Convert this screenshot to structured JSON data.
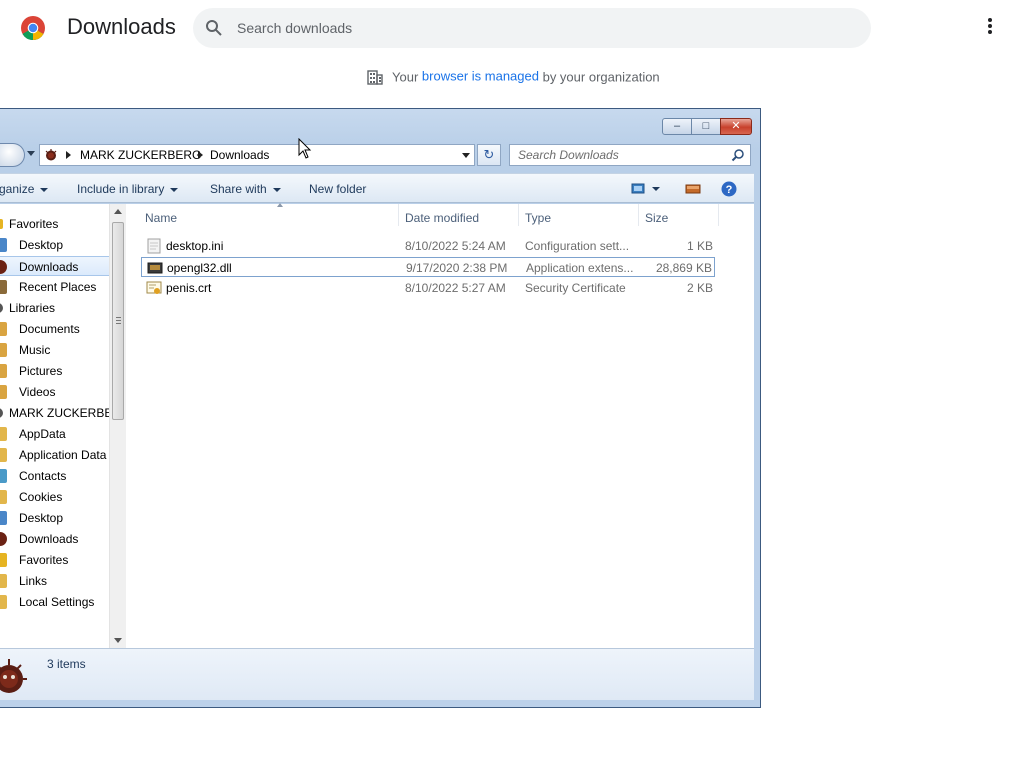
{
  "chrome": {
    "page_title": "Downloads",
    "search_placeholder": "Search downloads",
    "managed": {
      "prefix": "Your",
      "link": "browser is managed",
      "suffix": "by your organization"
    }
  },
  "explorer": {
    "breadcrumb": [
      "MARK ZUCKERBERG",
      "Downloads"
    ],
    "search_placeholder": "Search Downloads",
    "toolbar": {
      "organize": "ganize",
      "include_in_library": "Include in library",
      "share_with": "Share with",
      "new_folder": "New folder"
    },
    "nav_pane": [
      {
        "label": "Favorites",
        "icon": "star-icon",
        "group": true
      },
      {
        "label": "Desktop",
        "icon": "desktop-icon"
      },
      {
        "label": "Downloads",
        "icon": "downloads-folder-icon",
        "selected": true
      },
      {
        "label": "Recent Places",
        "icon": "recent-places-icon"
      },
      {
        "label": "Libraries",
        "icon": "libraries-icon",
        "group": true
      },
      {
        "label": "Documents",
        "icon": "documents-icon"
      },
      {
        "label": "Music",
        "icon": "music-icon"
      },
      {
        "label": "Pictures",
        "icon": "pictures-icon"
      },
      {
        "label": "Videos",
        "icon": "videos-icon"
      },
      {
        "label": "MARK ZUCKERBER",
        "icon": "user-icon",
        "group": true
      },
      {
        "label": "AppData",
        "icon": "folder-icon"
      },
      {
        "label": "Application Data",
        "icon": "folder-shortcut-icon"
      },
      {
        "label": "Contacts",
        "icon": "contacts-icon"
      },
      {
        "label": "Cookies",
        "icon": "folder-shortcut-icon"
      },
      {
        "label": "Desktop",
        "icon": "desktop-icon"
      },
      {
        "label": "Downloads",
        "icon": "downloads-folder-icon"
      },
      {
        "label": "Favorites",
        "icon": "star-icon"
      },
      {
        "label": "Links",
        "icon": "links-icon"
      },
      {
        "label": "Local Settings",
        "icon": "folder-shortcut-icon"
      }
    ],
    "columns": {
      "name": "Name",
      "date_modified": "Date modified",
      "type": "Type",
      "size": "Size"
    },
    "files": [
      {
        "name": "desktop.ini",
        "date": "8/10/2022 5:24 AM",
        "type": "Configuration sett...",
        "size": "1 KB",
        "icon": "ini-file-icon"
      },
      {
        "name": "opengl32.dll",
        "date": "9/17/2020 2:38 PM",
        "type": "Application extens...",
        "size": "28,869 KB",
        "icon": "dll-file-icon",
        "selected": true
      },
      {
        "name": "penis.crt",
        "date": "8/10/2022 5:27 AM",
        "type": "Security Certificate",
        "size": "2 KB",
        "icon": "certificate-file-icon"
      }
    ],
    "status": {
      "items_count": "3 items"
    }
  }
}
